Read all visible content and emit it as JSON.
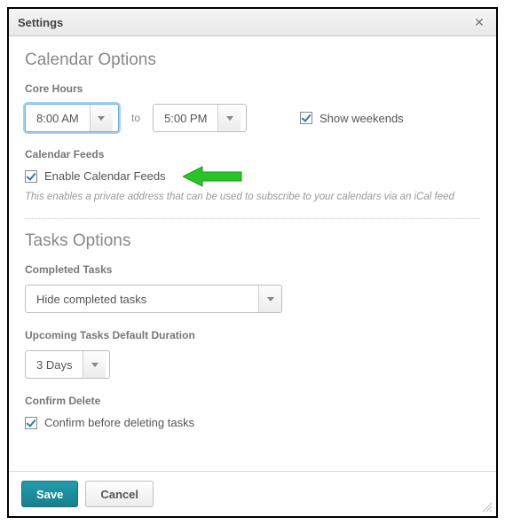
{
  "title": "Settings",
  "section_calendar": {
    "heading": "Calendar Options",
    "core_hours_label": "Core Hours",
    "core_start": "8:00 AM",
    "core_to": "to",
    "core_end": "5:00 PM",
    "show_weekends_label": "Show weekends",
    "show_weekends_checked": true,
    "feeds_label": "Calendar Feeds",
    "enable_feeds_label": "Enable Calendar Feeds",
    "enable_feeds_checked": true,
    "feeds_hint": "This enables a private address that can be used to subscribe to your calendars via an iCal feed"
  },
  "section_tasks": {
    "heading": "Tasks Options",
    "completed_label": "Completed Tasks",
    "completed_value": "Hide completed tasks",
    "upcoming_label": "Upcoming Tasks Default Duration",
    "upcoming_value": "3 Days",
    "confirm_label": "Confirm Delete",
    "confirm_checkbox_label": "Confirm before deleting tasks",
    "confirm_checked": true
  },
  "buttons": {
    "save": "Save",
    "cancel": "Cancel"
  }
}
